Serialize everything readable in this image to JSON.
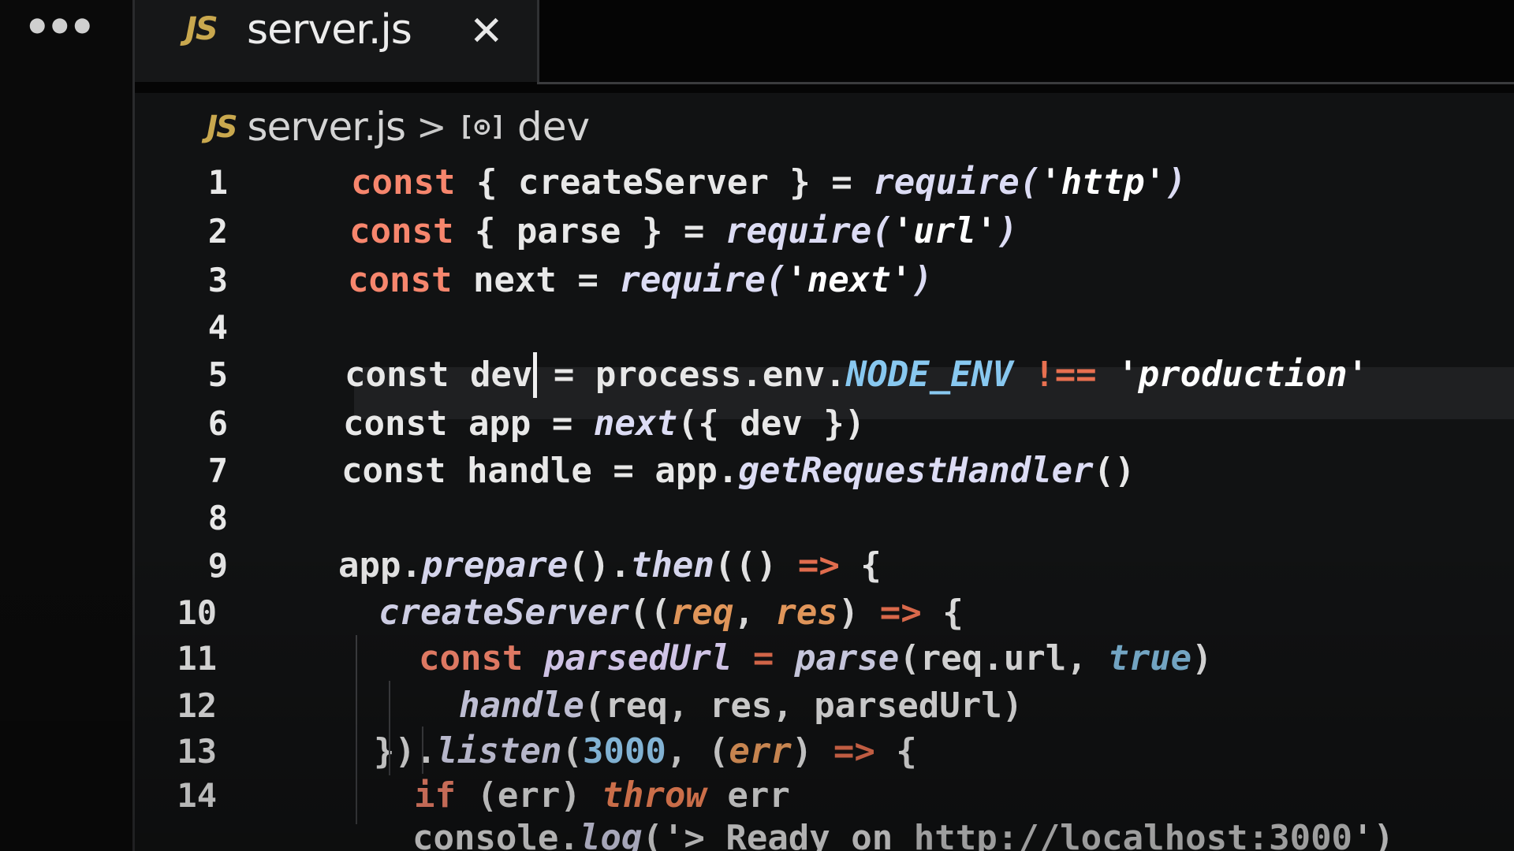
{
  "activity_bar": {
    "more_actions": "•••"
  },
  "tab": {
    "icon": "JS",
    "title": "server.js",
    "close": "✕"
  },
  "breadcrumb": {
    "file_icon": "JS",
    "file": "server.js",
    "separator": ">",
    "symbol_icon": "[⊙]",
    "symbol": "dev"
  },
  "editor": {
    "lines": [
      {
        "number": "1",
        "tokens": [
          [
            "kw",
            "const"
          ],
          [
            "var",
            " { createServer } = "
          ],
          [
            "fn",
            "require("
          ],
          [
            "str",
            "'http'"
          ],
          [
            "fn",
            ")"
          ]
        ]
      },
      {
        "number": "2",
        "tokens": [
          [
            "kw",
            "const"
          ],
          [
            "var",
            " { parse } = "
          ],
          [
            "fn",
            "require("
          ],
          [
            "str",
            "'url'"
          ],
          [
            "fn",
            ")"
          ]
        ]
      },
      {
        "number": "3",
        "tokens": [
          [
            "kw",
            "const"
          ],
          [
            "var",
            " next = "
          ],
          [
            "fn",
            "require("
          ],
          [
            "str",
            "'next'"
          ],
          [
            "fn",
            ")"
          ]
        ]
      },
      {
        "number": "4",
        "tokens": []
      },
      {
        "number": "5",
        "tokens": [
          [
            "var",
            "const dev"
          ],
          [
            "var",
            " = process.env."
          ],
          [
            "const-env",
            "NODE_ENV"
          ],
          [
            "var",
            " "
          ],
          [
            "op",
            "!=="
          ],
          [
            "var",
            " "
          ],
          [
            "str",
            "'production'"
          ]
        ]
      },
      {
        "number": "6",
        "tokens": [
          [
            "var",
            "const app = "
          ],
          [
            "fn",
            "next"
          ],
          [
            "var",
            "({ dev })"
          ]
        ]
      },
      {
        "number": "7",
        "tokens": [
          [
            "var",
            "const handle = app."
          ],
          [
            "fn",
            "getRequestHandler"
          ],
          [
            "var",
            "()"
          ]
        ]
      },
      {
        "number": "8",
        "tokens": []
      },
      {
        "number": "9",
        "tokens": [
          [
            "var",
            "app."
          ],
          [
            "fn",
            "prepare"
          ],
          [
            "var",
            "()."
          ],
          [
            "fn",
            "then"
          ],
          [
            "var",
            "(() "
          ],
          [
            "op",
            "=>"
          ],
          [
            "var",
            " {"
          ]
        ]
      },
      {
        "number": "10",
        "tokens": [
          [
            "var",
            "  "
          ],
          [
            "fn",
            "createServer"
          ],
          [
            "var",
            "(("
          ],
          [
            "param",
            "req"
          ],
          [
            "var",
            ", "
          ],
          [
            "param",
            "res"
          ],
          [
            "var",
            ") "
          ],
          [
            "op",
            "=>"
          ],
          [
            "var",
            " {"
          ]
        ]
      },
      {
        "number": "11",
        "tokens": [
          [
            "var",
            "    "
          ],
          [
            "kw",
            "const"
          ],
          [
            "var",
            " "
          ],
          [
            "prop",
            "parsedUrl"
          ],
          [
            "var",
            " "
          ],
          [
            "op",
            "="
          ],
          [
            "var",
            " "
          ],
          [
            "fn",
            "parse"
          ],
          [
            "var",
            "(req.url, "
          ],
          [
            "bool",
            "true"
          ],
          [
            "var",
            ")"
          ]
        ]
      },
      {
        "number": "12",
        "tokens": [
          [
            "var",
            "      "
          ],
          [
            "fn",
            "handle"
          ],
          [
            "var",
            "(req, res, parsedUrl)"
          ]
        ]
      },
      {
        "number": "13",
        "tokens": [
          [
            "var",
            "  })."
          ],
          [
            "fn",
            "listen"
          ],
          [
            "var",
            "("
          ],
          [
            "num",
            "3000"
          ],
          [
            "var",
            ", ("
          ],
          [
            "param",
            "err"
          ],
          [
            "var",
            ") "
          ],
          [
            "op",
            "=>"
          ],
          [
            "var",
            " {"
          ]
        ]
      },
      {
        "number": "14",
        "tokens": [
          [
            "var",
            "    "
          ],
          [
            "kw",
            "if"
          ],
          [
            "var",
            " (err) "
          ],
          [
            "err",
            "throw"
          ],
          [
            "var",
            " err"
          ]
        ]
      },
      {
        "number": "",
        "tokens": [
          [
            "var",
            "    console."
          ],
          [
            "fn",
            "log"
          ],
          [
            "var",
            "('> Ready on "
          ],
          [
            "url",
            "http://localhost:3000"
          ],
          [
            "var",
            "')"
          ]
        ]
      }
    ]
  }
}
